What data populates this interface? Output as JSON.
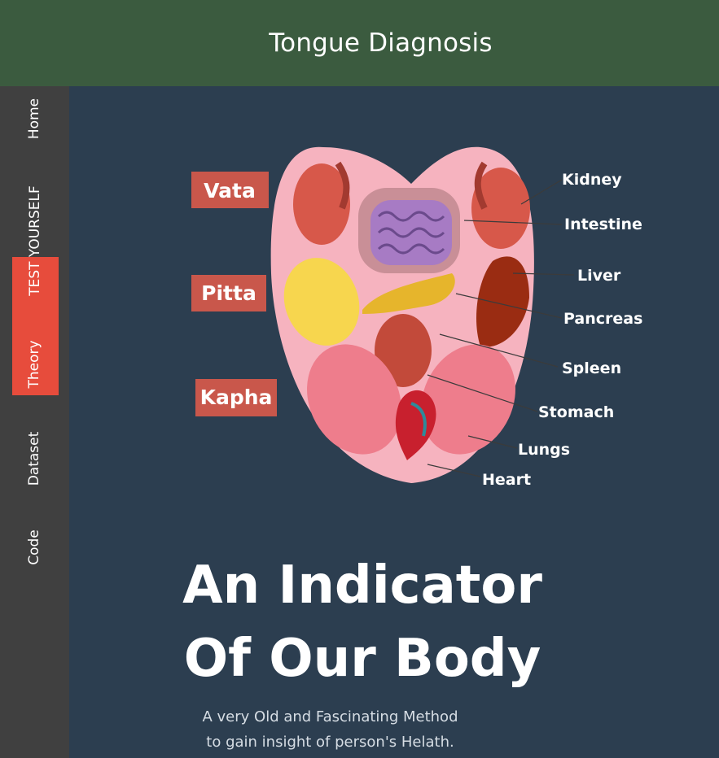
{
  "header": {
    "title": "Tongue Diagnosis"
  },
  "sidebar": {
    "items": [
      {
        "label": "Home",
        "active": false
      },
      {
        "label": "TEST YOURSELF",
        "active": true
      },
      {
        "label": "Theory",
        "active": false
      },
      {
        "label": "Dataset",
        "active": false
      },
      {
        "label": "Code",
        "active": false
      }
    ],
    "active_color": "#e74c3c"
  },
  "illustration": {
    "dosha_labels": [
      "Vata",
      "Pitta",
      "Kapha"
    ],
    "organ_labels": [
      "Kidney",
      "Intestine",
      "Liver",
      "Pancreas",
      "Spleen",
      "Stomach",
      "Lungs",
      "Heart"
    ]
  },
  "hero": {
    "title_line1": "An Indicator",
    "title_line2": "Of Our Body",
    "subtitle_line1": "A very Old and Fascinating Method",
    "subtitle_line2": "to gain insight of person's Helath."
  },
  "colors": {
    "header_bg": "#3b5b3f",
    "sidebar_bg": "#404040",
    "main_bg": "#2c3e50",
    "label_tag": "#c9574b"
  }
}
